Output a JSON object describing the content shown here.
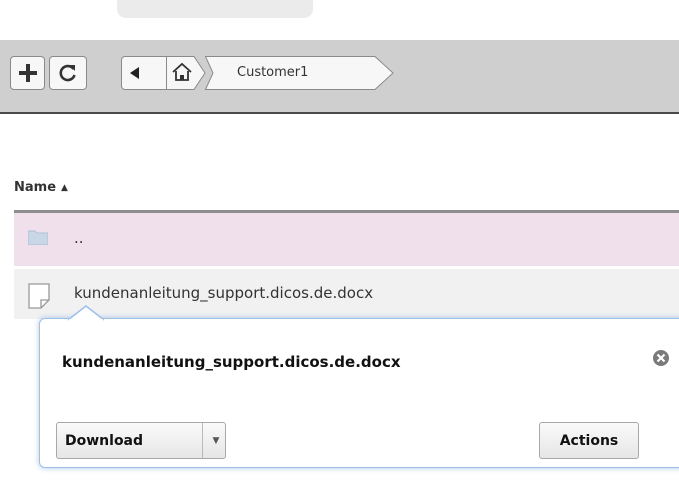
{
  "toolbar": {
    "new_icon": "plus-icon",
    "refresh_icon": "refresh-icon",
    "back_icon": "back-arrow-icon",
    "home_icon": "home-icon"
  },
  "breadcrumb": {
    "current": "Customer1"
  },
  "list": {
    "column_header": "Name",
    "sort_indicator": "▲",
    "rows": [
      {
        "label": "..",
        "icon": "folder-icon",
        "selected": true
      },
      {
        "label": "kundenanleitung_support.dicos.de.docx",
        "icon": "document-icon"
      }
    ]
  },
  "popup": {
    "title": "kundenanleitung_support.dicos.de.docx",
    "download_label": "Download",
    "actions_label": "Actions",
    "dropdown_glyph": "▼"
  },
  "colors": {
    "toolbar_bg": "#cfcfcf",
    "selected_row": "#f0e0ec",
    "popup_border": "#9fc0e8"
  }
}
